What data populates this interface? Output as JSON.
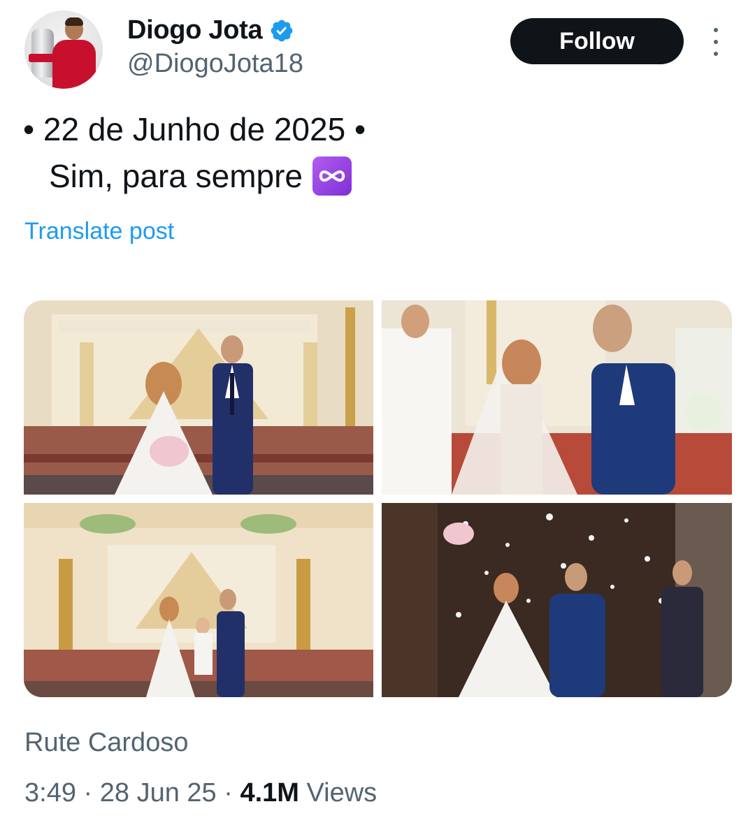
{
  "author": {
    "display_name": "Diogo Jota",
    "handle": "@DiogoJota18",
    "verified": true,
    "avatar_icon": "profile-photo-with-trophy"
  },
  "actions": {
    "follow_label": "Follow",
    "more_icon": "more-vertical-icon"
  },
  "tweet": {
    "line1": "• 22 de Junho de 2025 •",
    "line2": "Sim, para sempre",
    "emoji_icon": "infinity-emoji-icon",
    "translate_label": "Translate post"
  },
  "media": {
    "photos": [
      {
        "alt": "bride-and-groom-at-altar"
      },
      {
        "alt": "couple-showing-rings"
      },
      {
        "alt": "couple-with-child-at-altar"
      },
      {
        "alt": "couple-exiting-church-confetti"
      }
    ]
  },
  "credit": {
    "photographer": "Rute Cardoso"
  },
  "meta": {
    "time": "3:49",
    "date": "28 Jun 25",
    "separator": " · ",
    "views_count": "4.1M",
    "views_label": "Views"
  },
  "colors": {
    "text_primary": "#0f1419",
    "text_secondary": "#536471",
    "link": "#1d9bf0",
    "follow_bg": "#0f1419",
    "verified": "#1d9bf0"
  }
}
